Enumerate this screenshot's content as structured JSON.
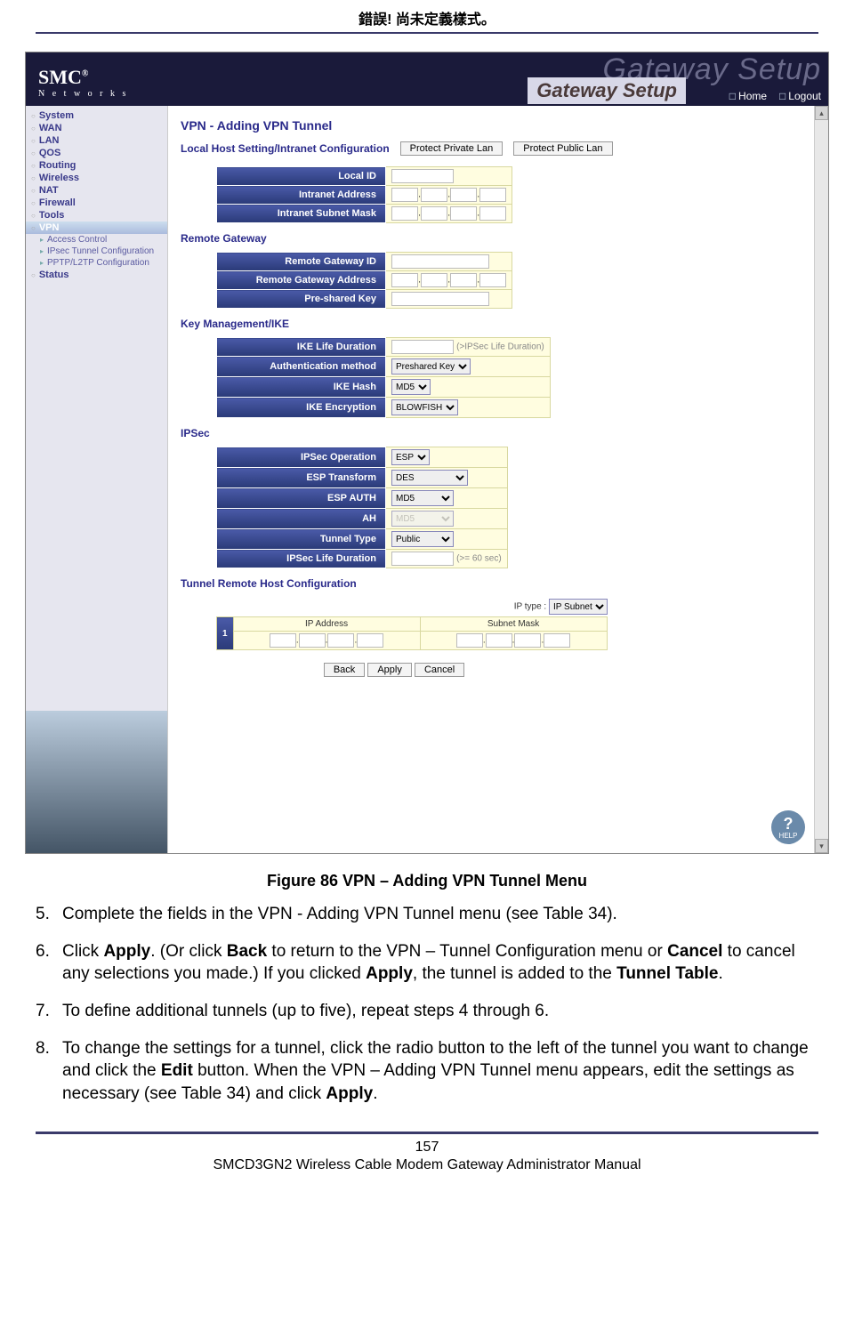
{
  "page_header": "錯誤! 尚未定義樣式。",
  "screenshot": {
    "logo_main": "SMC",
    "logo_reg": "®",
    "logo_sub": "N e t w o r k s",
    "ghost_title": "Gateway Setup",
    "overlay_title": "Gateway Setup",
    "nav_home": "Home",
    "nav_logout": "Logout",
    "sidebar": {
      "items": [
        {
          "label": "System",
          "sub": false
        },
        {
          "label": "WAN",
          "sub": false
        },
        {
          "label": "LAN",
          "sub": false
        },
        {
          "label": "QOS",
          "sub": false
        },
        {
          "label": "Routing",
          "sub": false
        },
        {
          "label": "Wireless",
          "sub": false
        },
        {
          "label": "NAT",
          "sub": false
        },
        {
          "label": "Firewall",
          "sub": false
        },
        {
          "label": "Tools",
          "sub": false
        },
        {
          "label": "VPN",
          "sub": false,
          "active": true
        },
        {
          "label": "Access Control",
          "sub": true
        },
        {
          "label": "IPsec Tunnel Configuration",
          "sub": true
        },
        {
          "label": "PPTP/L2TP Configuration",
          "sub": true
        },
        {
          "label": "Status",
          "sub": false
        }
      ]
    },
    "main": {
      "title": "VPN - Adding VPN Tunnel",
      "local_host_title": "Local Host Setting/Intranet Configuration",
      "btn_private": "Protect Private Lan",
      "btn_public": "Protect Public Lan",
      "local_rows": {
        "local_id": "Local ID",
        "intranet_addr": "Intranet Address",
        "intranet_mask": "Intranet Subnet Mask"
      },
      "remote_title": "Remote Gateway",
      "remote_rows": {
        "id": "Remote Gateway ID",
        "addr": "Remote Gateway Address",
        "psk": "Pre-shared Key"
      },
      "ike_title": "Key Management/IKE",
      "ike": {
        "life": "IKE Life Duration",
        "life_hint": "(>IPSec Life Duration)",
        "auth": "Authentication method",
        "auth_val": "Preshared Key",
        "hash": "IKE Hash",
        "hash_val": "MD5",
        "enc": "IKE Encryption",
        "enc_val": "BLOWFISH"
      },
      "ipsec_title": "IPSec",
      "ipsec": {
        "op": "IPSec Operation",
        "op_val": "ESP",
        "esp_t": "ESP Transform",
        "esp_t_val": "DES",
        "esp_a": "ESP AUTH",
        "esp_a_val": "MD5",
        "ah": "AH",
        "ah_val": "MD5",
        "tt": "Tunnel Type",
        "tt_val": "Public",
        "life": "IPSec Life Duration",
        "life_hint": "(>= 60 sec)"
      },
      "tunnel_cfg_title": "Tunnel Remote Host Configuration",
      "ip_type_label": "IP type :",
      "ip_type_val": "IP Subnet",
      "ip_hdr_addr": "IP Address",
      "ip_hdr_mask": "Subnet Mask",
      "row_idx": "1",
      "btn_back": "Back",
      "btn_apply": "Apply",
      "btn_cancel": "Cancel",
      "help": "HELP"
    }
  },
  "caption": "Figure 86 VPN – Adding VPN Tunnel Menu",
  "steps": {
    "s5_num": "5.",
    "s5": "Complete the fields in the VPN - Adding VPN Tunnel menu (see Table 34).",
    "s6_num": "6.",
    "s6_pre": "Click ",
    "s6_b1": "Apply",
    "s6_mid1": ". (Or click ",
    "s6_b2": "Back",
    "s6_mid2": " to return to the VPN – Tunnel Configuration menu or ",
    "s6_b3": "Cancel",
    "s6_mid3": " to cancel any selections you made.) If you clicked ",
    "s6_b4": "Apply",
    "s6_mid4": ", the tunnel is added to the ",
    "s6_b5": "Tunnel Table",
    "s6_end": ".",
    "s7_num": "7.",
    "s7": "To define additional tunnels (up to five), repeat steps 4 through 6.",
    "s8_num": "8.",
    "s8_pre": "To change the settings for a tunnel, click the radio button to the left of the tunnel you want to change and click the ",
    "s8_b1": "Edit",
    "s8_mid1": " button. When the VPN – Adding VPN Tunnel menu appears, edit the settings as necessary (see Table 34) and click ",
    "s8_b2": "Apply",
    "s8_end": "."
  },
  "footer": {
    "page_num": "157",
    "manual": "SMCD3GN2 Wireless Cable Modem Gateway Administrator Manual"
  }
}
